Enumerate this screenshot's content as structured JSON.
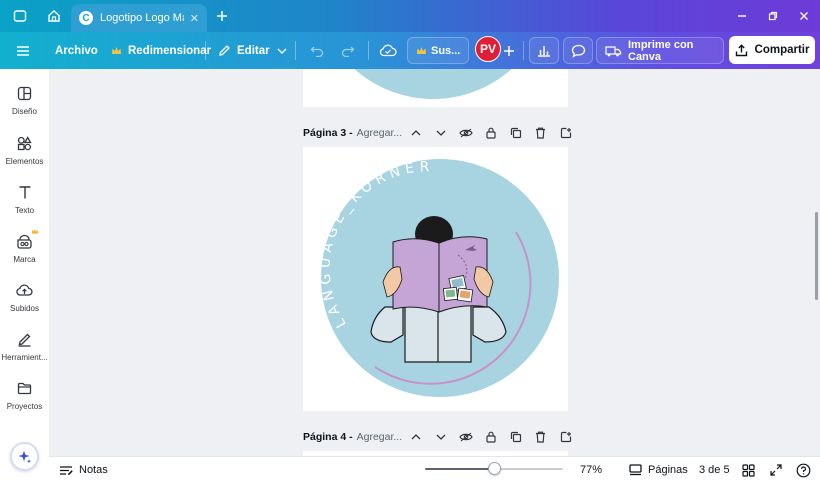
{
  "browser": {
    "tab_title": "Logotipo Logo Mar...",
    "tab_favicon": "C",
    "new_tab_icon": "plus-icon",
    "window_controls": [
      "minimize-icon",
      "restore-icon",
      "close-icon"
    ]
  },
  "toolbar": {
    "menu_icon": "hamburger-icon",
    "file_label": "Archivo",
    "resize_label": "Redimensionar",
    "edit_label": "Editar",
    "upgrade_label": "Sus...",
    "avatar_initials": "PV",
    "print_label": "Imprime con Canva",
    "share_label": "Compartir"
  },
  "sidebar": {
    "items": [
      {
        "label": "Diseño",
        "icon": "layout-icon"
      },
      {
        "label": "Elementos",
        "icon": "shapes-icon"
      },
      {
        "label": "Texto",
        "icon": "text-icon"
      },
      {
        "label": "Marca",
        "icon": "brand-icon"
      },
      {
        "label": "Subidos",
        "icon": "cloud-upload-icon"
      },
      {
        "label": "Herramient...",
        "icon": "pen-tool-icon"
      },
      {
        "label": "Proyectos",
        "icon": "folder-icon"
      }
    ]
  },
  "pages": {
    "page3_label": "Página 3 -",
    "page3_placeholder": "Agregar...",
    "page4_label": "Página 4 -",
    "page4_placeholder": "Agregar..."
  },
  "logo": {
    "text": "LANGUAGE_KORNER",
    "circle_color": "#a8d4e2",
    "book_color": "#c5a4d6",
    "shirt_color": "#d9e5ea"
  },
  "bottombar": {
    "notes_label": "Notas",
    "zoom_label": "77%",
    "zoom_level": 0.5,
    "pages_label": "Páginas",
    "page_counter": "3 de 5"
  },
  "colors": {
    "accent": "#7d2ae8",
    "avatar_bg": "#e01f36"
  }
}
